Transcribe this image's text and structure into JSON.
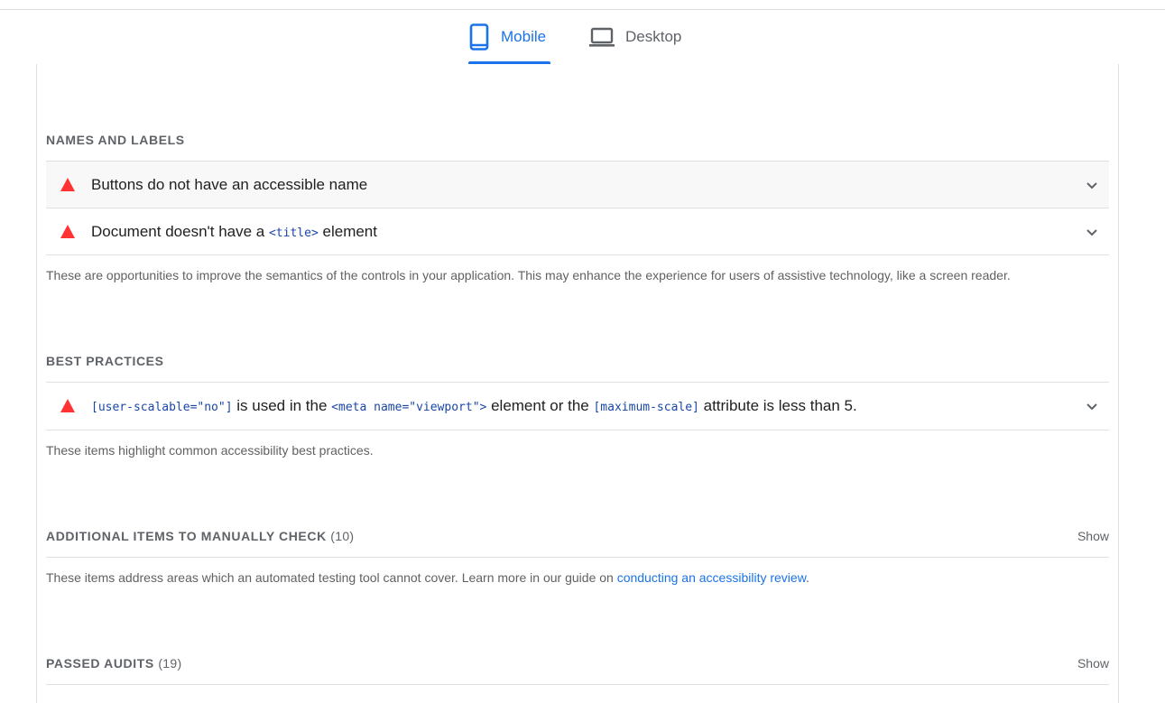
{
  "tabs": {
    "mobile": "Mobile",
    "desktop": "Desktop"
  },
  "colors": {
    "accent": "#1a73e8",
    "fail": "#ff3333",
    "code": "#1a47a6"
  },
  "groups": {
    "names_labels": {
      "title": "NAMES AND LABELS",
      "audit1": {
        "title": "Buttons do not have an accessible name",
        "icon": "fail-triangle-icon"
      },
      "audit2": {
        "pre": "Document doesn't have a ",
        "code": "<title>",
        "post": " element",
        "icon": "fail-triangle-icon"
      },
      "description": "These are opportunities to improve the semantics of the controls in your application. This may enhance the experience for users of assistive technology, like a screen reader."
    },
    "best_practices": {
      "title": "BEST PRACTICES",
      "audit1": {
        "code1": "[user-scalable=\"no\"]",
        "text1": " is used in the ",
        "code2": "<meta name=\"viewport\">",
        "text2": " element or the ",
        "code3": "[maximum-scale]",
        "text3": " attribute is less than 5.",
        "icon": "fail-triangle-icon"
      },
      "description": "These items highlight common accessibility best practices."
    },
    "manual": {
      "title": "ADDITIONAL ITEMS TO MANUALLY CHECK",
      "count": "(10)",
      "show": "Show",
      "description_pre": "These items address areas which an automated testing tool cannot cover. Learn more in our guide on ",
      "link": "conducting an accessibility review",
      "description_post": "."
    },
    "passed": {
      "title": "PASSED AUDITS",
      "count": "(19)",
      "show": "Show"
    }
  }
}
